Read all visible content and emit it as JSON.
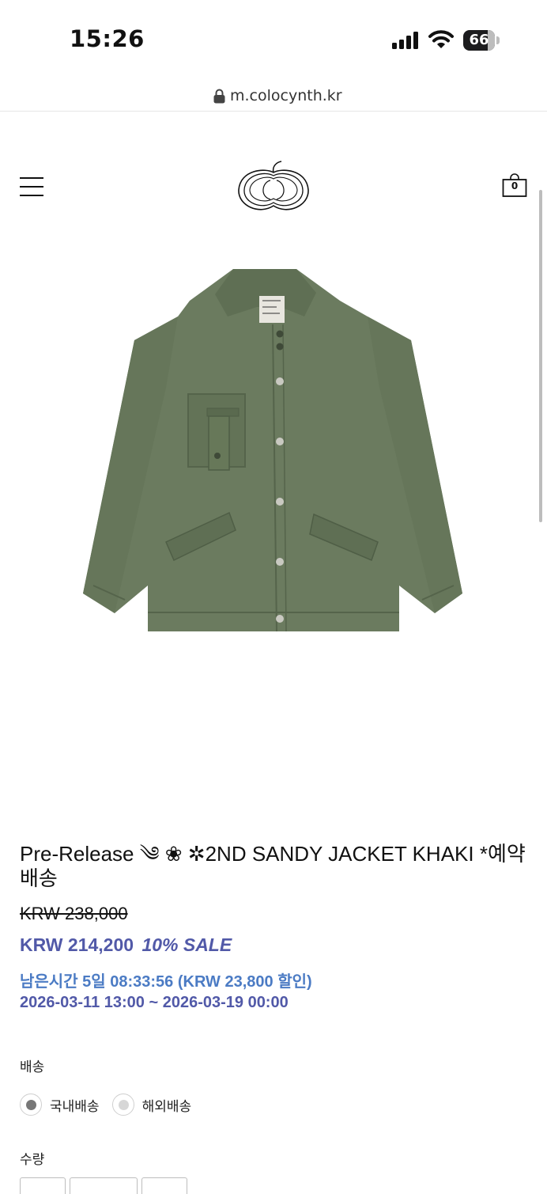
{
  "status_bar": {
    "time": "15:26",
    "battery": "66"
  },
  "browser": {
    "url": "m.colocynth.kr"
  },
  "header": {
    "cart_count": "0"
  },
  "product": {
    "title": "Pre-Release ༄ ❀ ✲2ND SANDY JACKET KHAKI *예약배송",
    "original_price": "KRW 238,000",
    "sale_price": "KRW 214,200",
    "sale_percent": "10% SALE",
    "time_remaining": "남은시간 5일 08:33:56 (KRW 23,800 할인)",
    "sale_period": "2026-03-11 13:00 ~ 2026-03-19 00:00"
  },
  "shipping": {
    "label": "배송",
    "options": [
      {
        "label": "국내배송",
        "selected": true
      },
      {
        "label": "해외배송",
        "selected": false
      }
    ]
  },
  "quantity": {
    "label": "수량"
  },
  "colors": {
    "sale": "#5159a8",
    "timer": "#4b7bc4",
    "jacket": "#6b7b5f"
  }
}
